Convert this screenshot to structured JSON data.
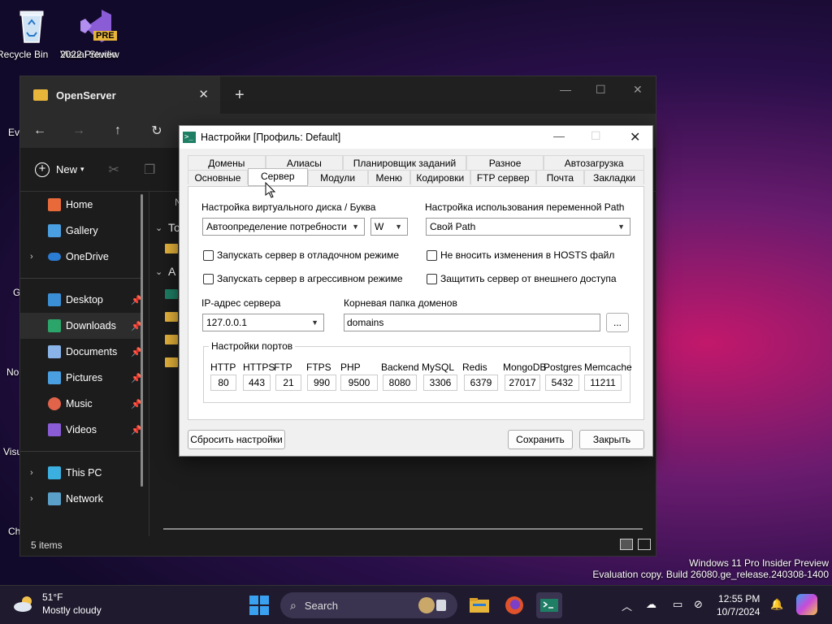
{
  "desktop": {
    "recycle_bin": "Recycle Bin",
    "vs_line1": "Visual Studio",
    "vs_line2": "2022 Preview",
    "vs_badge": "PRE",
    "side_labels": [
      "Ev",
      "G",
      "No",
      "Visu",
      "Ch"
    ]
  },
  "explorer": {
    "tab_title": "OpenServer",
    "new_label": "New",
    "sidebar": {
      "home": "Home",
      "gallery": "Gallery",
      "onedrive": "OneDrive",
      "desktop": "Desktop",
      "downloads": "Downloads",
      "documents": "Documents",
      "pictures": "Pictures",
      "music": "Music",
      "videos": "Videos",
      "this_pc": "This PC",
      "network": "Network"
    },
    "partial_header": "N",
    "partial_group1": "To",
    "partial_group2": "A",
    "status": "5 items"
  },
  "dialog": {
    "title": "Настройки [Профиль: Default]",
    "tabs_row1": [
      "Домены",
      "Алиасы",
      "Планировщик заданий",
      "Разное",
      "Автозагрузка"
    ],
    "tabs_row2": [
      "Основные",
      "Сервер",
      "Модули",
      "Меню",
      "Кодировки",
      "FTP сервер",
      "Почта",
      "Закладки"
    ],
    "active_tab": "Сервер",
    "disk_label": "Настройка виртуального диска / Буква",
    "disk_value": "Автоопределение потребности",
    "drive_letter": "W",
    "path_label": "Настройка использования переменной Path",
    "path_value": "Свой Path",
    "chk_debug": "Запускать сервер в отладочном режиме",
    "chk_hosts": "Не вносить изменения в HOSTS файл",
    "chk_aggressive": "Запускать сервер в агрессивном режиме",
    "chk_protect": "Защитить сервер от внешнего доступа",
    "ip_label": "IP-адрес сервера",
    "ip_value": "127.0.0.1",
    "root_label": "Корневая папка доменов",
    "root_value": "domains",
    "browse": "...",
    "ports_title": "Настройки портов",
    "ports": [
      {
        "name": "HTTP",
        "value": "80"
      },
      {
        "name": "HTTPS",
        "value": "443"
      },
      {
        "name": "FTP",
        "value": "21"
      },
      {
        "name": "FTPS",
        "value": "990"
      },
      {
        "name": "PHP",
        "value": "9500"
      },
      {
        "name": "Backend",
        "value": "8080"
      },
      {
        "name": "MySQL",
        "value": "3306"
      },
      {
        "name": "Redis",
        "value": "6379"
      },
      {
        "name": "MongoDB",
        "value": "27017"
      },
      {
        "name": "Postgres",
        "value": "5432"
      },
      {
        "name": "Memcache",
        "value": "11211"
      }
    ],
    "reset": "Сбросить настройки",
    "save": "Сохранить",
    "close": "Закрыть"
  },
  "watermark": {
    "line1": "Windows 11 Pro Insider Preview",
    "line2": "Evaluation copy. Build 26080.ge_release.240308-1400"
  },
  "taskbar": {
    "temp": "51°F",
    "weather": "Mostly cloudy",
    "search": "Search",
    "time": "12:55 PM",
    "date": "10/7/2024"
  }
}
